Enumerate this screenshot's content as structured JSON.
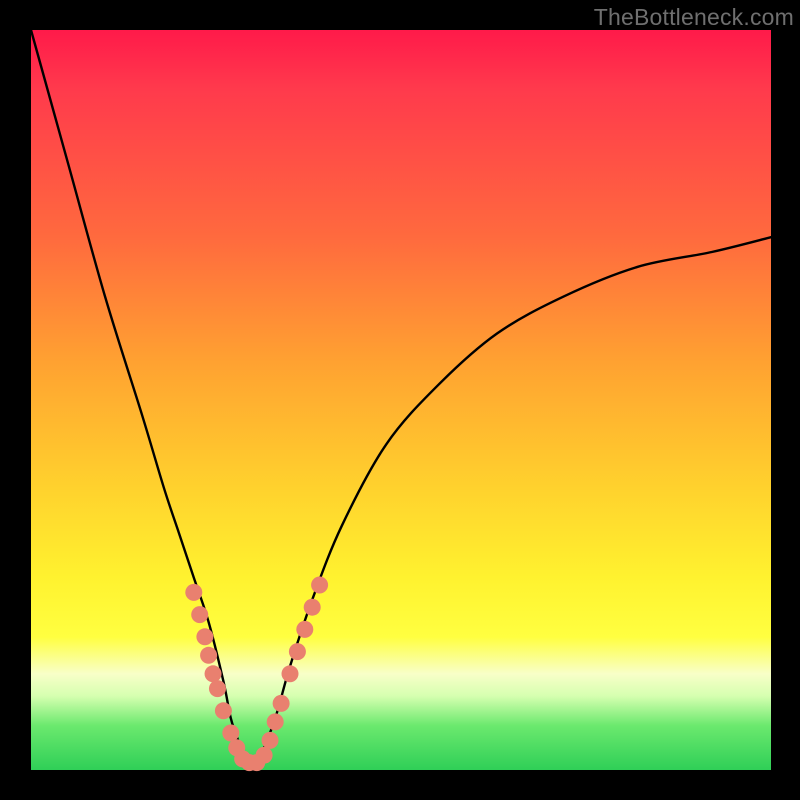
{
  "watermark": "TheBottleneck.com",
  "chart_data": {
    "type": "line",
    "title": "",
    "xlabel": "",
    "ylabel": "",
    "xlim": [
      0,
      100
    ],
    "ylim": [
      0,
      100
    ],
    "series": [
      {
        "name": "curve",
        "x": [
          0,
          5,
          10,
          15,
          18,
          20,
          22,
          24,
          26,
          27,
          28,
          29,
          30,
          31,
          33,
          35,
          38,
          42,
          48,
          55,
          63,
          72,
          82,
          92,
          100
        ],
        "y": [
          100,
          82,
          64,
          48,
          38,
          32,
          26,
          20,
          12,
          7,
          4,
          2,
          1,
          2,
          7,
          14,
          23,
          33,
          44,
          52,
          59,
          64,
          68,
          70,
          72
        ]
      }
    ],
    "scatter": {
      "name": "marks",
      "points": [
        {
          "x": 22.0,
          "y": 24
        },
        {
          "x": 22.8,
          "y": 21
        },
        {
          "x": 23.5,
          "y": 18
        },
        {
          "x": 24.0,
          "y": 15.5
        },
        {
          "x": 24.6,
          "y": 13
        },
        {
          "x": 25.2,
          "y": 11
        },
        {
          "x": 26.0,
          "y": 8
        },
        {
          "x": 27.0,
          "y": 5
        },
        {
          "x": 27.8,
          "y": 3
        },
        {
          "x": 28.6,
          "y": 1.5
        },
        {
          "x": 29.5,
          "y": 1
        },
        {
          "x": 30.5,
          "y": 1
        },
        {
          "x": 31.5,
          "y": 2
        },
        {
          "x": 32.3,
          "y": 4
        },
        {
          "x": 33.0,
          "y": 6.5
        },
        {
          "x": 33.8,
          "y": 9
        },
        {
          "x": 35.0,
          "y": 13
        },
        {
          "x": 36.0,
          "y": 16
        },
        {
          "x": 37.0,
          "y": 19
        },
        {
          "x": 38.0,
          "y": 22
        },
        {
          "x": 39.0,
          "y": 25
        }
      ]
    },
    "gradient_stops": [
      {
        "pos": 0.0,
        "color": "#ff1a4a"
      },
      {
        "pos": 0.28,
        "color": "#ff6a3e"
      },
      {
        "pos": 0.62,
        "color": "#ffd22d"
      },
      {
        "pos": 0.82,
        "color": "#ffff40"
      },
      {
        "pos": 0.9,
        "color": "#d6ffb0"
      },
      {
        "pos": 1.0,
        "color": "#2fcf57"
      }
    ]
  }
}
